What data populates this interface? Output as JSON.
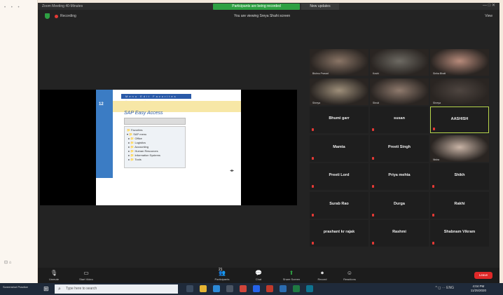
{
  "window": {
    "title": "Zoom Meeting 40-Minutes",
    "banner": "Participants are being recorded",
    "update_label": "New updates",
    "controls": "—  □  ✕"
  },
  "topbar": {
    "recording_label": "Recording",
    "viewing_label": "You are viewing Sreya Shahi screen",
    "view_label": "View"
  },
  "shared_slide": {
    "side_number": "12",
    "menu": "Menu   Edit   Favorites   Extras   Help",
    "app_title": "SAP Easy Access",
    "tree": [
      "Favorites",
      "SAP menu",
      "Office",
      "Logistics",
      "Accounting",
      "Human Resources",
      "Information Systems",
      "Tools"
    ]
  },
  "participants": [
    {
      "name": "Bishnu Prasad",
      "video": true,
      "tone": "#8a7566"
    },
    {
      "name": "Koshi",
      "video": true,
      "tone": "#6d6a63"
    },
    {
      "name": "Sinha Bhatt",
      "video": true,
      "tone": "#b88b7b"
    },
    {
      "name": "Shreya",
      "video": true,
      "tone": "#9e8f7a"
    },
    {
      "name": "Shruti",
      "video": true,
      "tone": "#8f7a6d"
    },
    {
      "name": "Shreya",
      "video": true,
      "tone": "#4e4540"
    },
    {
      "name": "Bhumi garr",
      "video": false
    },
    {
      "name": "susan",
      "video": false
    },
    {
      "name": "AASHISH",
      "video": false,
      "active": true
    },
    {
      "name": "Mamta",
      "video": false
    },
    {
      "name": "Preeti Singh",
      "video": false
    },
    {
      "name": "Nisha",
      "video": true,
      "tone": "#c9b4a6"
    },
    {
      "name": "Preeti Lord",
      "video": false
    },
    {
      "name": "Priya mehta",
      "video": false
    },
    {
      "name": "Shikh",
      "video": false
    },
    {
      "name": "Surab Rao",
      "video": false
    },
    {
      "name": "Durga",
      "video": false
    },
    {
      "name": "Rakhi",
      "video": false
    },
    {
      "name": "prashant kr rajak",
      "video": false
    },
    {
      "name": "Rashmi",
      "video": false
    },
    {
      "name": "Shabnam Vikram",
      "video": false
    }
  ],
  "controls": [
    {
      "icon": "🎙",
      "label": "Unmute"
    },
    {
      "icon": "▭",
      "label": "Start Video"
    },
    {
      "icon": "👥",
      "label": "Participants"
    },
    {
      "icon": "💬",
      "label": "Chat"
    },
    {
      "icon": "⬆",
      "label": "Share Screen"
    },
    {
      "icon": "⏺",
      "label": "Record"
    },
    {
      "icon": "☺",
      "label": "Reactions"
    }
  ],
  "participants_count": "21",
  "end_label": "Leave",
  "taskbar": {
    "search_placeholder": "Type here to search",
    "time": "4:04 PM",
    "date": "11/25/2020",
    "left_text": "Screenshot\nPractice",
    "sys_text": "^ ◻ ⋯ ENG"
  },
  "colors": {
    "zoom_bg": "#232323",
    "active_border": "#b7d44a",
    "end_button": "#e02828",
    "record_dot": "#e53935",
    "shield": "#2ea043"
  }
}
